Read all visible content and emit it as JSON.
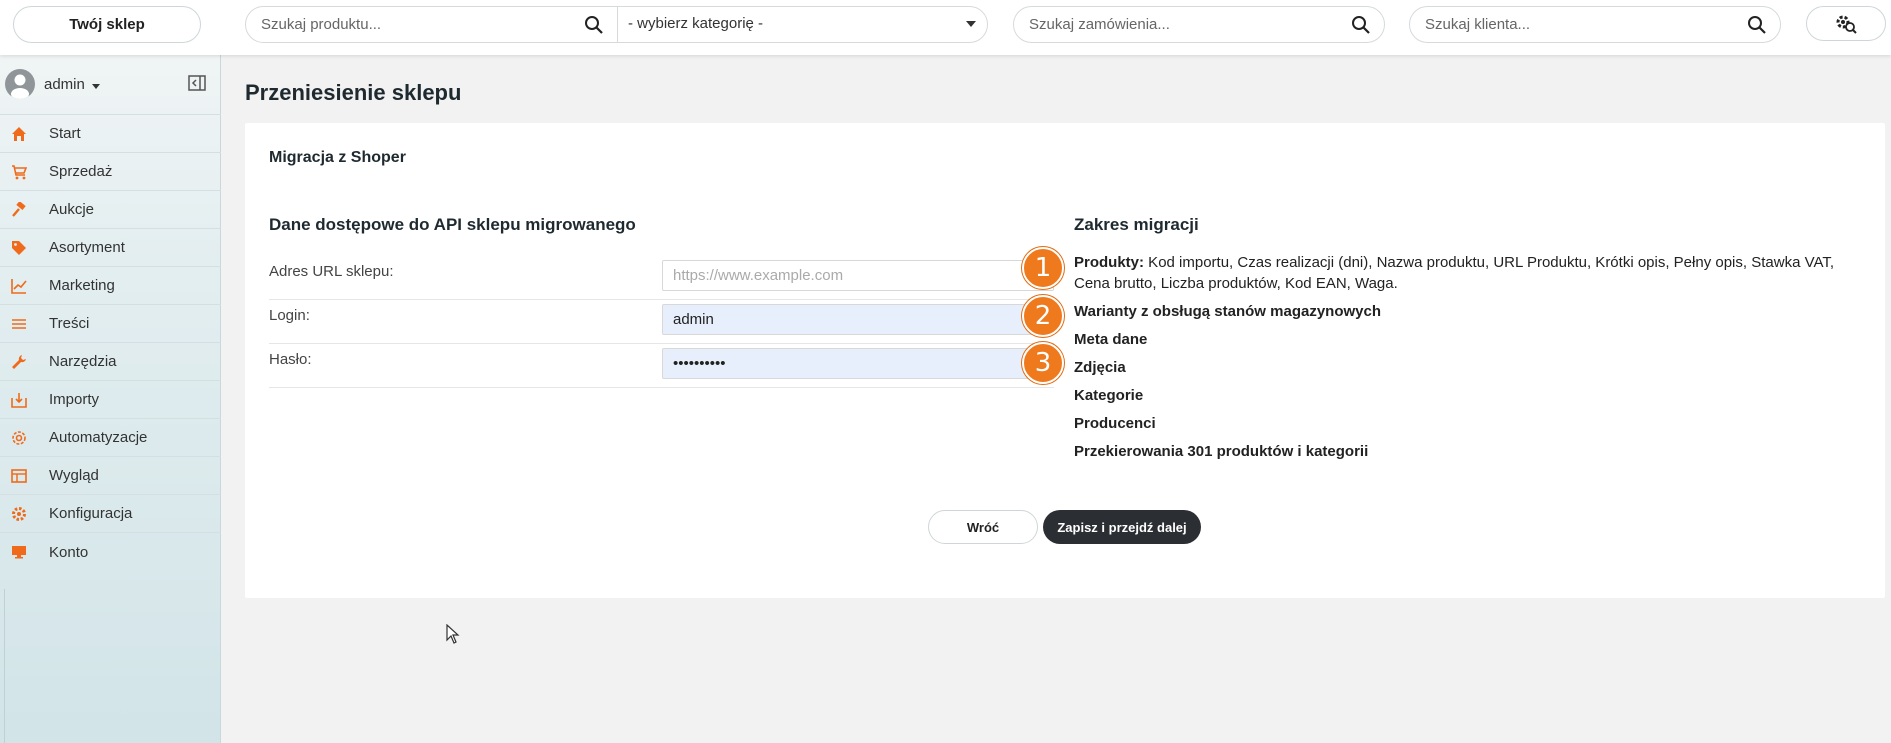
{
  "topbar": {
    "shop_label": "Twój sklep",
    "product_search_placeholder": "Szukaj produktu...",
    "category_select": "- wybierz kategorię -",
    "order_search_placeholder": "Szukaj zamówienia...",
    "client_search_placeholder": "Szukaj klienta...",
    "icons": [
      "search-icon",
      "chevron-down-icon",
      "settings-search-icon"
    ]
  },
  "sidebar": {
    "user": "admin",
    "items": [
      {
        "label": "Start",
        "icon": "home-icon"
      },
      {
        "label": "Sprzedaż",
        "icon": "cart-icon"
      },
      {
        "label": "Aukcje",
        "icon": "hammer-icon"
      },
      {
        "label": "Asortyment",
        "icon": "tag-icon"
      },
      {
        "label": "Marketing",
        "icon": "chart-icon"
      },
      {
        "label": "Treści",
        "icon": "lines-icon"
      },
      {
        "label": "Narzędzia",
        "icon": "wrench-icon"
      },
      {
        "label": "Importy",
        "icon": "import-icon"
      },
      {
        "label": "Automatyzacje",
        "icon": "automation-icon"
      },
      {
        "label": "Wygląd",
        "icon": "layout-icon"
      },
      {
        "label": "Konfiguracja",
        "icon": "gear-icon"
      },
      {
        "label": "Konto",
        "icon": "monitor-icon"
      }
    ],
    "accent_color": "#ef6a1a"
  },
  "main": {
    "page_title": "Przeniesienie sklepu",
    "card_title": "Migracja z Shoper",
    "api_section_title": "Dane dostępowe do API sklepu migrowanego",
    "fields": {
      "url_label": "Adres URL sklepu:",
      "url_placeholder": "https://www.example.com",
      "login_label": "Login:",
      "login_value": "admin",
      "password_label": "Hasło:",
      "password_value": "••••••••••"
    },
    "scope_title": "Zakres migracji",
    "scope": {
      "products_bold": "Produkty:",
      "products_rest": " Kod importu, Czas realizacji (dni), Nazwa produktu, URL Produktu, Krótki opis, Pełny opis, Stawka VAT, Cena brutto, Liczba produktów, Kod EAN, Waga.",
      "variants": "Warianty z obsługą stanów magazynowych",
      "meta": "Meta dane",
      "photos": "Zdjęcia",
      "categories": "Kategorie",
      "producers": "Producenci",
      "redirects": "Przekierowania 301 produktów i kategorii"
    },
    "badges": [
      "1",
      "2",
      "3"
    ],
    "back_button": "Wróć",
    "next_button": "Zapisz i przejdź dalej"
  }
}
